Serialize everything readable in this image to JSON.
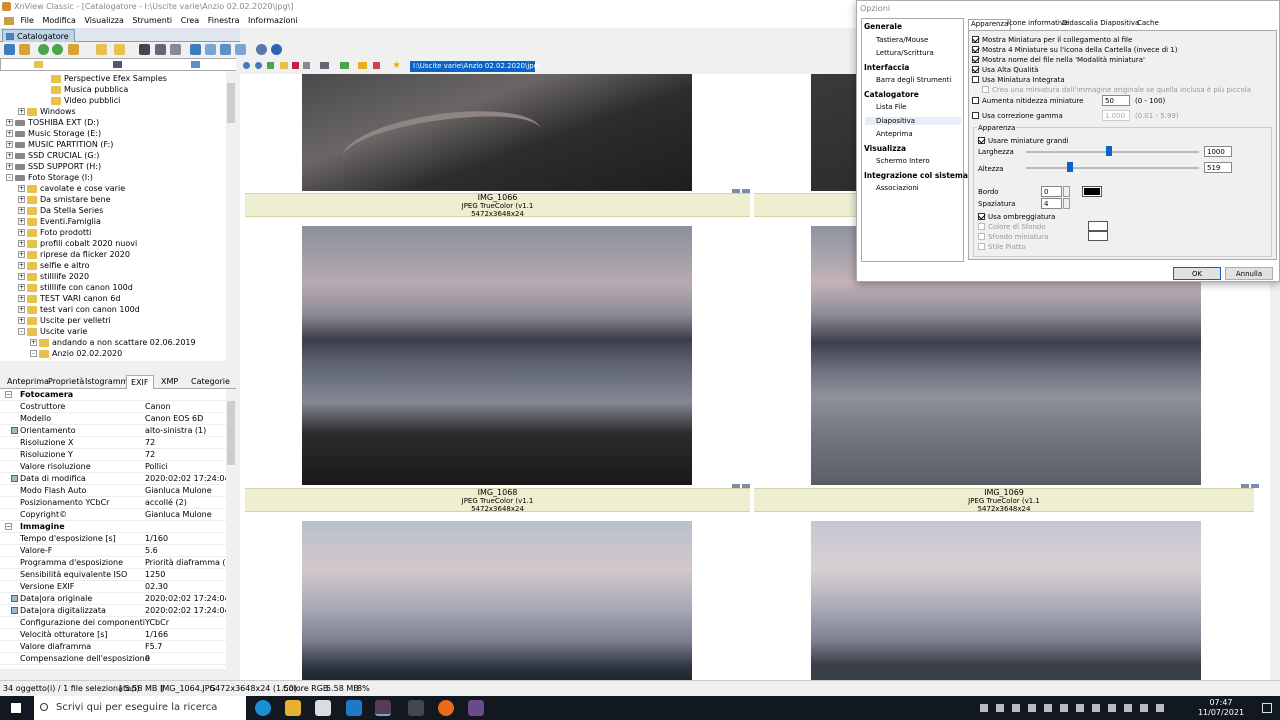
{
  "window": {
    "title": "XnView Classic - [Catalogatore - I:\\Uscite varie\\Anzio 02.02.2020\\jpg\\]"
  },
  "menu": [
    "File",
    "Modifica",
    "Visualizza",
    "Strumenti",
    "Crea",
    "Finestra",
    "Informazioni"
  ],
  "tab": {
    "label": "Catalogatore"
  },
  "address": "I:\\Uscite varie\\Anzio 02.02.2020\\jpg\\",
  "tree": [
    {
      "label": "Perspective Efex Samples",
      "indent": 4,
      "type": "folder",
      "exp": ""
    },
    {
      "label": "Musica pubblica",
      "indent": 4,
      "type": "folder",
      "exp": ""
    },
    {
      "label": "Video pubblici",
      "indent": 4,
      "type": "folder",
      "exp": ""
    },
    {
      "label": "Windows",
      "indent": 2,
      "type": "folder",
      "exp": "+"
    },
    {
      "label": "TOSHIBA EXT (D:)",
      "indent": 1,
      "type": "drive",
      "exp": "+"
    },
    {
      "label": "Music Storage (E:)",
      "indent": 1,
      "type": "drive",
      "exp": "+"
    },
    {
      "label": "MUSIC PARTITION (F:)",
      "indent": 1,
      "type": "drive",
      "exp": "+"
    },
    {
      "label": "SSD CRUCIAL (G:)",
      "indent": 1,
      "type": "drive",
      "exp": "+"
    },
    {
      "label": "SSD SUPPORT (H:)",
      "indent": 1,
      "type": "drive",
      "exp": "+"
    },
    {
      "label": "Foto Storage (I:)",
      "indent": 1,
      "type": "drive",
      "exp": "-"
    },
    {
      "label": "cavolate e cose varie",
      "indent": 2,
      "type": "folder",
      "exp": "+"
    },
    {
      "label": "Da smistare bene",
      "indent": 2,
      "type": "folder",
      "exp": "+"
    },
    {
      "label": "Da Stella Series",
      "indent": 2,
      "type": "folder",
      "exp": "+"
    },
    {
      "label": "Eventi.Famiglia",
      "indent": 2,
      "type": "folder",
      "exp": "+"
    },
    {
      "label": "Foto prodotti",
      "indent": 2,
      "type": "folder",
      "exp": "+"
    },
    {
      "label": "profili cobalt 2020 nuovi",
      "indent": 2,
      "type": "folder",
      "exp": "+"
    },
    {
      "label": "riprese da flicker 2020",
      "indent": 2,
      "type": "folder",
      "exp": "+"
    },
    {
      "label": "selfie e altro",
      "indent": 2,
      "type": "folder",
      "exp": "+"
    },
    {
      "label": "stilllife 2020",
      "indent": 2,
      "type": "folder",
      "exp": "+"
    },
    {
      "label": "stilllife con canon 100d",
      "indent": 2,
      "type": "folder",
      "exp": "+"
    },
    {
      "label": "TEST VARI canon 6d",
      "indent": 2,
      "type": "folder",
      "exp": "+"
    },
    {
      "label": "test vari con canon 100d",
      "indent": 2,
      "type": "folder",
      "exp": "+"
    },
    {
      "label": "Uscite per velletri",
      "indent": 2,
      "type": "folder",
      "exp": "+"
    },
    {
      "label": "Uscite varie",
      "indent": 2,
      "type": "folder",
      "exp": "-"
    },
    {
      "label": "andando a non scattare 02.06.2019",
      "indent": 3,
      "type": "folder",
      "exp": "+"
    },
    {
      "label": "Anzio 02.02.2020",
      "indent": 3,
      "type": "folder",
      "exp": "-"
    }
  ],
  "lower_tabs": [
    "Anteprima",
    "Proprietà",
    "Istogramma",
    "EXIF",
    "XMP",
    "Categorie"
  ],
  "exif": [
    {
      "k": "Fotocamera",
      "v": "",
      "sec": true
    },
    {
      "k": "Costruttore",
      "v": "Canon"
    },
    {
      "k": "Modello",
      "v": "Canon EOS 6D"
    },
    {
      "k": "Orientamento",
      "v": "alto-sinistra (1)",
      "mark": true
    },
    {
      "k": "Risoluzione X",
      "v": "72"
    },
    {
      "k": "Risoluzione Y",
      "v": "72"
    },
    {
      "k": "Valore risoluzione",
      "v": "Pollici"
    },
    {
      "k": "Data di modifica",
      "v": "2020:02:02 17:24:04",
      "mark": true
    },
    {
      "k": "Modo Flash Auto",
      "v": "Gianluca Mulone"
    },
    {
      "k": "Posizionamento YCbCr",
      "v": "accollé (2)"
    },
    {
      "k": "Copyright©",
      "v": "Gianluca Mulone"
    },
    {
      "k": "Immagine",
      "v": "",
      "sec": true
    },
    {
      "k": "Tempo d'esposizione [s]",
      "v": "1/160"
    },
    {
      "k": "Valore-F",
      "v": "5.6"
    },
    {
      "k": "Programma d'esposizione",
      "v": "Priorità diaframma (3)"
    },
    {
      "k": "Sensibilità equivalente ISO",
      "v": "1250"
    },
    {
      "k": "Versione EXIF",
      "v": "02.30"
    },
    {
      "k": "Data|ora originale",
      "v": "2020:02:02 17:24:04",
      "mark": true
    },
    {
      "k": "Data|ora digitalizzata",
      "v": "2020:02:02 17:24:04",
      "mark": true
    },
    {
      "k": "Configurazione dei componenti",
      "v": "YCbCr"
    },
    {
      "k": "Velocità otturatore [s]",
      "v": "1/166"
    },
    {
      "k": "Valore diaframma",
      "v": "F5.7"
    },
    {
      "k": "Compensazione dell'esposizione",
      "v": "0"
    }
  ],
  "thumbs": [
    {
      "name": "IMG_1066",
      "info": "JPEG TrueColor (v1.1",
      "size": "5472x3648x24"
    },
    {
      "name": "IMG_1068",
      "info": "JPEG TrueColor (v1.1",
      "size": "5472x3648x24"
    },
    {
      "name": "IMG_1069",
      "info": "JPEG TrueColor (v1.1",
      "size": "5472x3648x24"
    }
  ],
  "status": {
    "count": "34 oggetto(i) / 1 file selezionato(i)",
    "filesize": "[ 5.58 MB ]",
    "file": "IMG_1064.JPG",
    "dims": "5472x3648x24 (1.50)",
    "color": "Colore RGB",
    "mem": "5.58 MB",
    "zoom": "8%"
  },
  "taskbar": {
    "search": "Scrivi qui per eseguire la ricerca",
    "time": "07:47",
    "date": "11/07/2021"
  },
  "dialog": {
    "title": "Opzioni",
    "nav": [
      {
        "label": "Generale",
        "h": true
      },
      {
        "label": "Tastiera/Mouse"
      },
      {
        "label": "Lettura/Scrittura"
      },
      {
        "label": "Interfaccia",
        "h": true
      },
      {
        "label": "Barra degli Strumenti"
      },
      {
        "label": "Catalogatore",
        "h": true
      },
      {
        "label": "Lista File"
      },
      {
        "label": "Diapositiva",
        "sel": true
      },
      {
        "label": "Anteprima"
      },
      {
        "label": "Visualizza",
        "h": true
      },
      {
        "label": "Schermo Intero"
      },
      {
        "label": "Integrazione col sistema",
        "h": true
      },
      {
        "label": "Associazioni"
      }
    ],
    "tabs": [
      "Apparenza",
      "Icone informative",
      "Didascalia Diapositiva",
      "Cache"
    ],
    "checks": {
      "c1": "Mostra Miniatura per il collegamento al file",
      "c2": "Mostra 4 Miniature su l'icona della Cartella (invece di 1)",
      "c3": "Mostra nome del file nella 'Modalità miniatura'",
      "c4": "Usa Alta Qualità",
      "c5": "Usa Miniatura Integrata",
      "c6": "Crea una miniatura dall'immagine originale se quella inclusa è più piccola",
      "c7": "Aumenta nitidezza miniature",
      "c7v": "50",
      "c7r": "(0 - 100)",
      "c8": "Usa correzione gamma",
      "c8v": "1.000",
      "c8r": "(0.01 - 5.99)"
    },
    "appearance": {
      "group": "Apparenza",
      "big": "Usare miniature grandi",
      "width_label": "Larghezza",
      "width": "1000",
      "height_label": "Altezza",
      "height": "519",
      "border_label": "Bordo",
      "border": "0",
      "spacing_label": "Spaziatura",
      "spacing": "4",
      "shadow": "Usa ombreggiatura",
      "bg": "Colore di Sfondo",
      "thumbbg": "Sfondo miniatura",
      "flat": "Stile Piatto"
    },
    "ok": "OK",
    "cancel": "Annulla"
  },
  "colors": {
    "accent": "#0a64c8",
    "caption": "#eeeed0"
  }
}
